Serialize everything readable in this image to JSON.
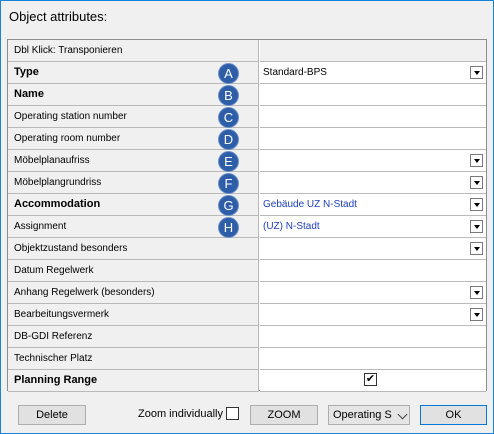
{
  "window": {
    "title": "Object attributes:"
  },
  "rows": [
    {
      "label": "Dbl Klick: Transponieren",
      "bold": false,
      "value": "",
      "badge": "",
      "dropdown": false,
      "checkbox": false,
      "header": true
    },
    {
      "label": "Type",
      "bold": true,
      "value": "Standard-BPS",
      "badge": "A",
      "dropdown": true,
      "checkbox": false
    },
    {
      "label": "Name",
      "bold": true,
      "value": "",
      "badge": "B",
      "dropdown": false,
      "checkbox": false
    },
    {
      "label": "Operating station number",
      "bold": false,
      "value": "",
      "badge": "C",
      "dropdown": false,
      "checkbox": false
    },
    {
      "label": "Operating room number",
      "bold": false,
      "value": "",
      "badge": "D",
      "dropdown": false,
      "checkbox": false
    },
    {
      "label": "Möbelplanaufriss",
      "bold": false,
      "value": "",
      "badge": "E",
      "dropdown": true,
      "checkbox": false
    },
    {
      "label": "Möbelplangrundriss",
      "bold": false,
      "value": "",
      "badge": "F",
      "dropdown": true,
      "checkbox": false
    },
    {
      "label": "Accommodation",
      "bold": true,
      "value": "Gebäude UZ N-Stadt",
      "badge": "G",
      "dropdown": true,
      "checkbox": false,
      "blue": true
    },
    {
      "label": "Assignment",
      "bold": false,
      "value": "(UZ) N-Stadt",
      "badge": "H",
      "dropdown": true,
      "checkbox": false,
      "blue": true
    },
    {
      "label": "Objektzustand besonders",
      "bold": false,
      "value": "",
      "badge": "",
      "dropdown": true,
      "checkbox": false
    },
    {
      "label": "Datum Regelwerk",
      "bold": false,
      "value": "",
      "badge": "",
      "dropdown": false,
      "checkbox": false
    },
    {
      "label": "Anhang Regelwerk (besonders)",
      "bold": false,
      "value": "",
      "badge": "",
      "dropdown": true,
      "checkbox": false
    },
    {
      "label": "Bearbeitungsvermerk",
      "bold": false,
      "value": "",
      "badge": "",
      "dropdown": true,
      "checkbox": false
    },
    {
      "label": "DB-GDI Referenz",
      "bold": false,
      "value": "",
      "badge": "",
      "dropdown": false,
      "checkbox": false
    },
    {
      "label": "Technischer Platz",
      "bold": false,
      "value": "",
      "badge": "",
      "dropdown": false,
      "checkbox": false
    },
    {
      "label": "Planning Range",
      "bold": true,
      "value": "",
      "badge": "",
      "dropdown": false,
      "checkbox": true,
      "checked": true
    }
  ],
  "footer": {
    "delete_label": "Delete",
    "zoom_individually_label": "Zoom individually",
    "zoom_individually_checked": false,
    "zoom_label": "ZOOM",
    "combo_value": "Operating S",
    "ok_label": "OK"
  },
  "colors": {
    "badge": "#2f5ea8",
    "value_link": "#1f3fbf",
    "window_border": "#1883d7"
  }
}
